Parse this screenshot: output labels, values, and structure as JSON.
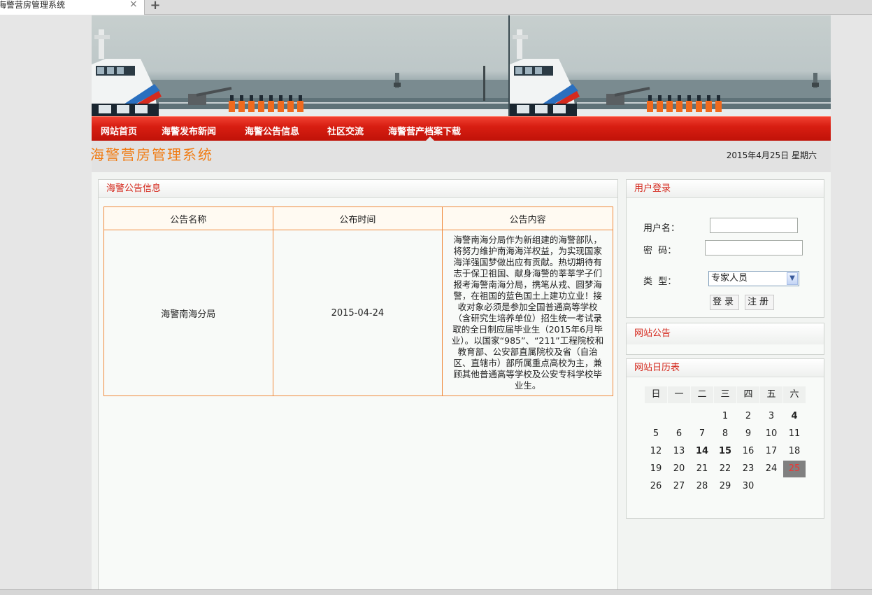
{
  "browser": {
    "tab_title": "海警营房管理系统",
    "close_glyph": "×",
    "new_tab_glyph": "+"
  },
  "nav": {
    "items": [
      {
        "label": "网站首页"
      },
      {
        "label": "海警发布新闻"
      },
      {
        "label": "海警公告信息"
      },
      {
        "label": "社区交流"
      },
      {
        "label": "海警营产档案下载"
      }
    ]
  },
  "header": {
    "site_title": "海警营房管理系统",
    "date": "2015年4月25日 星期六"
  },
  "notice_panel": {
    "title": "海警公告信息",
    "columns": [
      "公告名称",
      "公布时间",
      "公告内容"
    ],
    "rows": [
      {
        "name": "海警南海分局",
        "date": "2015-04-24",
        "content": "海警南海分局作为新组建的海警部队，将努力维护南海海洋权益，为实现国家海洋强国梦做出应有贡献。热切期待有志于保卫祖国、献身海警的莘莘学子们报考海警南海分局，携笔从戎、圆梦海警，在祖国的蓝色国土上建功立业！接收对象必须是参加全国普通高等学校（含研究生培养单位）招生统一考试录取的全日制应届毕业生（2015年6月毕业）。以国家“985”、“211”工程院校和教育部、公安部直属院校及省（自治区、直辖市）部所属重点高校为主，兼顾其他普通高等学校及公安专科学校毕业生。"
      }
    ]
  },
  "login": {
    "title": "用户登录",
    "username_label": "用户名：",
    "username_value": "",
    "password_label": "密  码：",
    "password_value": "",
    "type_label": "类  型：",
    "type_selected": "专家人员",
    "login_button": "登录",
    "register_button": "注册"
  },
  "site_notice": {
    "title": "网站公告"
  },
  "calendar": {
    "title": "网站日历表",
    "weekdays": [
      "日",
      "一",
      "二",
      "三",
      "四",
      "五",
      "六"
    ],
    "weeks": [
      [
        "",
        "",
        "",
        "1",
        "2",
        "3",
        "4"
      ],
      [
        "5",
        "6",
        "7",
        "8",
        "9",
        "10",
        "11"
      ],
      [
        "12",
        "13",
        "14",
        "15",
        "16",
        "17",
        "18"
      ],
      [
        "19",
        "20",
        "21",
        "22",
        "23",
        "24",
        "25"
      ],
      [
        "26",
        "27",
        "28",
        "29",
        "30",
        "",
        ""
      ]
    ],
    "bold_days": [
      "4",
      "14",
      "15"
    ],
    "today": "25",
    "today_color": "#ee3333"
  },
  "colors": {
    "nav_red": "#d81e12",
    "title_orange": "#f07c14",
    "panel_title_red": "#d4261a",
    "table_border_orange": "#f08a3c"
  }
}
